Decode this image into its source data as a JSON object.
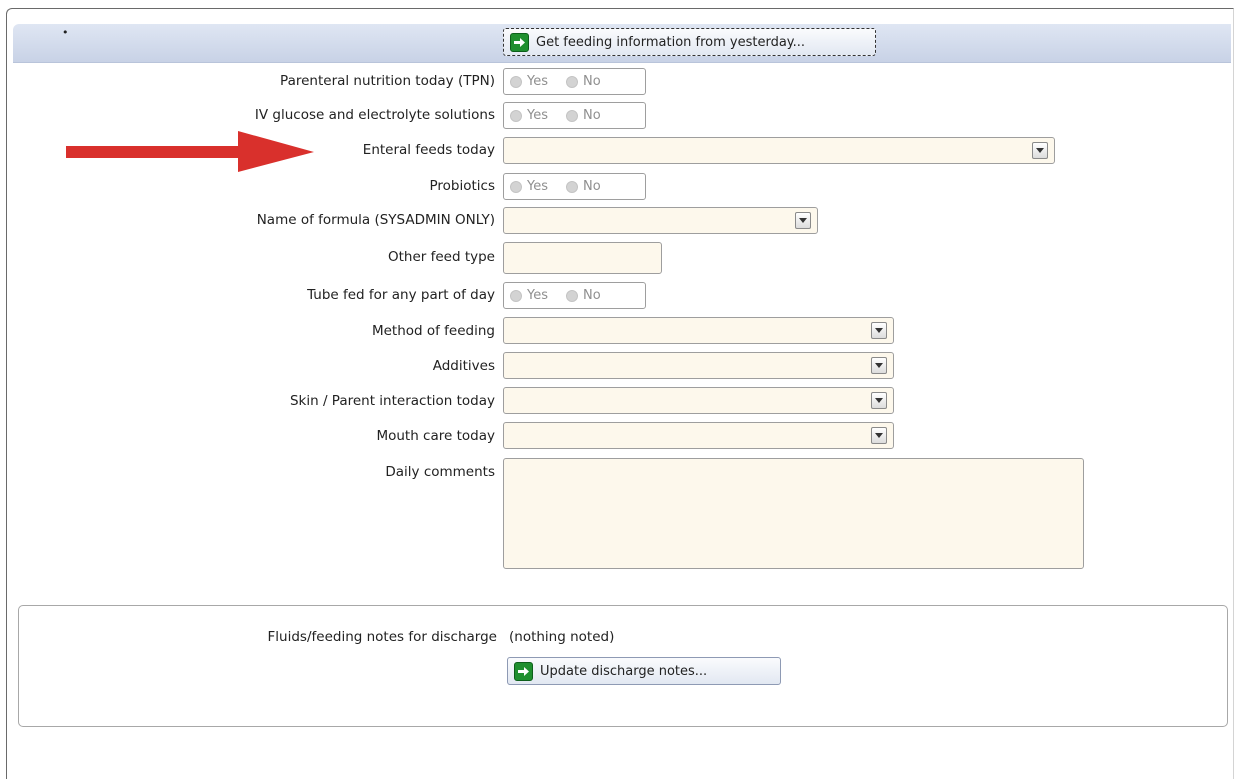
{
  "header": {
    "get_feeding_label": "Get feeding information from yesterday..."
  },
  "form": {
    "tpn": {
      "label": "Parenteral nutrition today (TPN)",
      "yes": "Yes",
      "no": "No"
    },
    "iv_glucose": {
      "label": "IV glucose and electrolyte solutions",
      "yes": "Yes",
      "no": "No"
    },
    "enteral": {
      "label": "Enteral feeds today",
      "value": ""
    },
    "probiotics": {
      "label": "Probiotics",
      "yes": "Yes",
      "no": "No"
    },
    "formula": {
      "label": "Name of formula (SYSADMIN ONLY)",
      "value": ""
    },
    "other_feed": {
      "label": "Other feed type",
      "value": ""
    },
    "tube_fed": {
      "label": "Tube fed for any part of day",
      "yes": "Yes",
      "no": "No"
    },
    "method": {
      "label": "Method of feeding",
      "value": ""
    },
    "additives": {
      "label": "Additives",
      "value": ""
    },
    "skin": {
      "label": "Skin / Parent interaction today",
      "value": ""
    },
    "mouth": {
      "label": "Mouth care today",
      "value": ""
    },
    "comments": {
      "label": "Daily comments",
      "value": ""
    }
  },
  "discharge": {
    "label": "Fluids/feeding notes for discharge",
    "value": "(nothing noted)",
    "update_label": "Update discharge notes..."
  },
  "colors": {
    "field_bg": "#fdf8ec",
    "header_band": "#d3dcec",
    "arrow_red": "#d9302c",
    "go_icon_green": "#1f8f2f"
  },
  "icons": [
    "go-arrow-icon",
    "dropdown-arrow-icon",
    "annotation-arrow-icon"
  ]
}
